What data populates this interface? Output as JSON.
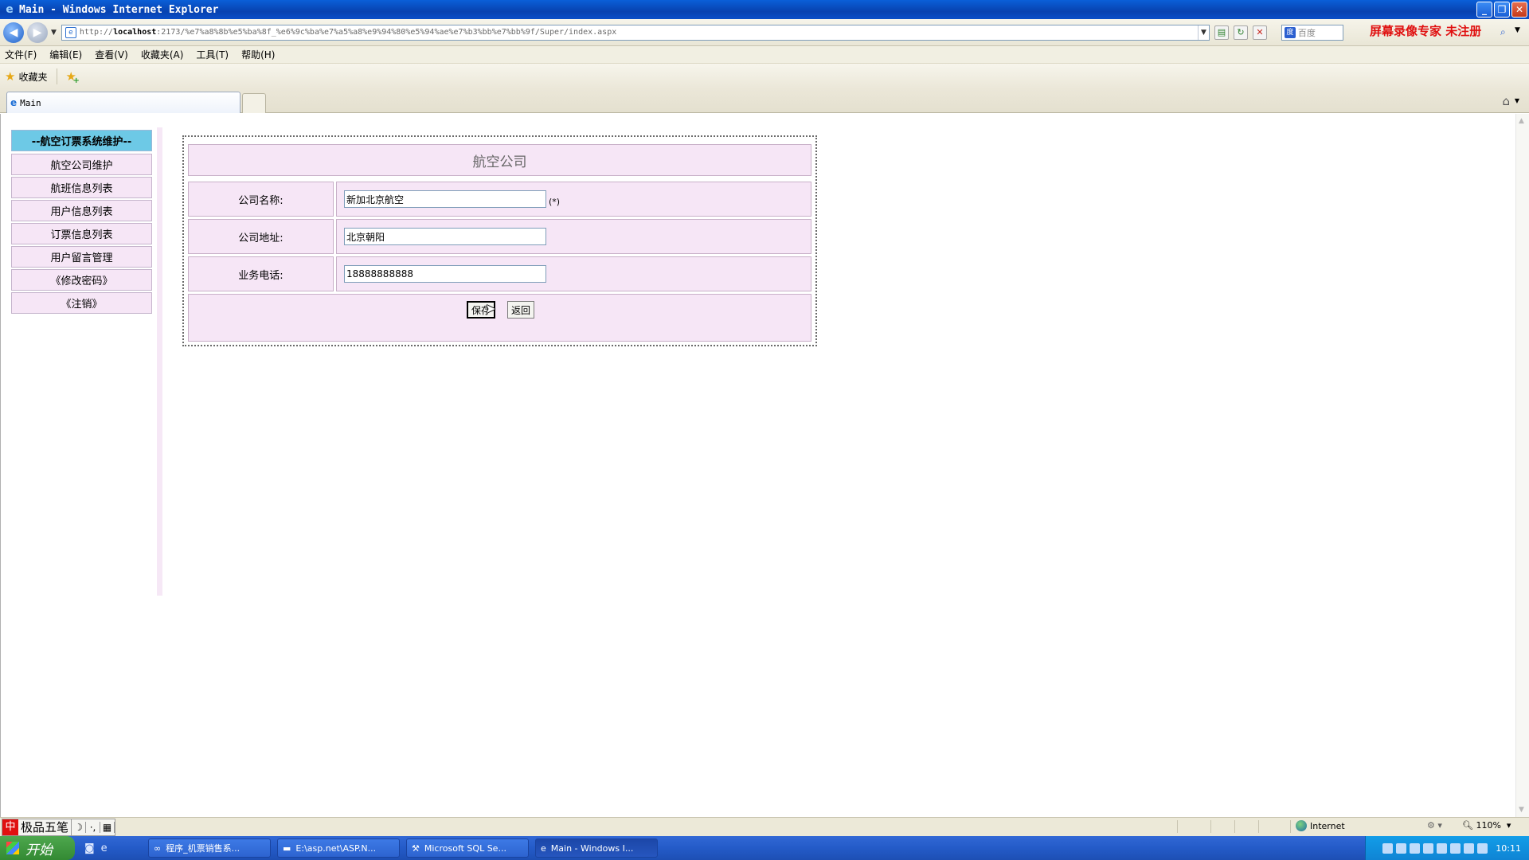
{
  "window": {
    "title": "Main - Windows Internet Explorer",
    "minimize": "_",
    "maximize": "❐",
    "close": "✕"
  },
  "address": {
    "url_prefix": "http://",
    "url_host": "localhost",
    "url_rest": ":2173/%e7%a8%8b%e5%ba%8f_%e6%9c%ba%e7%a5%a8%e9%94%80%e5%94%ae%e7%b3%bb%e7%bb%9f/Super/index.aspx",
    "search_placeholder": "百度",
    "watermark": "屏幕录像专家  未注册"
  },
  "menu": [
    "文件(F)",
    "编辑(E)",
    "查看(V)",
    "收藏夹(A)",
    "工具(T)",
    "帮助(H)"
  ],
  "favorites": {
    "label": "收藏夹"
  },
  "tab": {
    "label": "Main"
  },
  "sidebar": {
    "header": "--航空订票系统维护--",
    "items": [
      "航空公司维护",
      "航班信息列表",
      "用户信息列表",
      "订票信息列表",
      "用户留言管理",
      "《修改密码》",
      "《注销》"
    ]
  },
  "form": {
    "title": "航空公司",
    "fields": [
      {
        "label": "公司名称:",
        "value": "新加北京航空",
        "required_mark": "(*)"
      },
      {
        "label": "公司地址:",
        "value": "北京朝阳"
      },
      {
        "label": "业务电话:",
        "value": "18888888888"
      }
    ],
    "save_label": "保存",
    "back_label": "返回"
  },
  "status": {
    "zone": "Internet",
    "zoom": "110%",
    "ime_name": "极品五笔"
  },
  "taskbar": {
    "start": "开始",
    "items": [
      {
        "label": "程序_机票销售系...",
        "icon": "vs-icon"
      },
      {
        "label": "E:\\asp.net\\ASP.N...",
        "icon": "folder-icon"
      },
      {
        "label": "Microsoft SQL Se...",
        "icon": "sql-icon"
      },
      {
        "label": "Main - Windows I...",
        "icon": "ie-icon",
        "active": true
      }
    ],
    "clock": "10:11"
  }
}
